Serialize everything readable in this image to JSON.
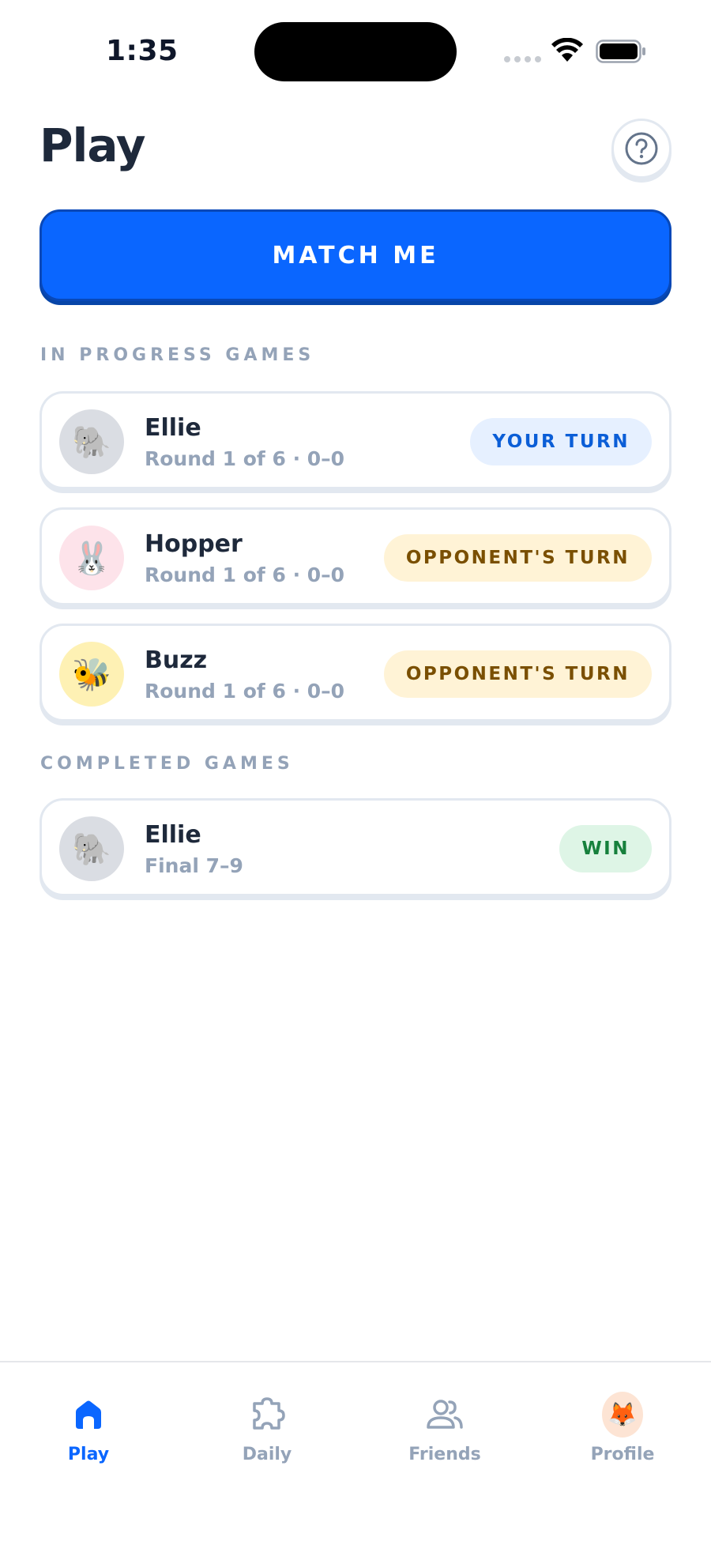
{
  "status_bar": {
    "time": "1:35"
  },
  "header": {
    "title": "Play",
    "help_icon": "question-circle-icon"
  },
  "match_button": {
    "label": "MATCH ME"
  },
  "in_progress": {
    "label": "IN PROGRESS GAMES",
    "games": [
      {
        "name": "Ellie",
        "subtitle": "Round 1 of 6 · 0–0",
        "avatar": "🐘",
        "avatar_bg": "#dadde3",
        "status": "YOUR TURN"
      },
      {
        "name": "Hopper",
        "subtitle": "Round 1 of 6 · 0–0",
        "avatar": "🐰",
        "avatar_bg": "#fde3ea",
        "status": "OPPONENT'S TURN"
      },
      {
        "name": "Buzz",
        "subtitle": "Round 1 of 6 · 0–0",
        "avatar": "🐝",
        "avatar_bg": "#fef1b4",
        "status": "OPPONENT'S TURN"
      }
    ]
  },
  "completed": {
    "label": "COMPLETED GAMES",
    "games": [
      {
        "name": "Ellie",
        "subtitle": "Final 7–9",
        "avatar": "🐘",
        "avatar_bg": "#dadde3",
        "status": "WIN"
      }
    ]
  },
  "tab_bar": {
    "tabs": [
      {
        "label": "Play",
        "icon": "home-icon",
        "active": true
      },
      {
        "label": "Daily",
        "icon": "puzzle-icon",
        "active": false
      },
      {
        "label": "Friends",
        "icon": "friends-icon",
        "active": false
      },
      {
        "label": "Profile",
        "icon": "fox-avatar",
        "active": false
      }
    ],
    "profile_avatar": "🦊"
  },
  "colors": {
    "accent": "#0a66ff",
    "your_turn_bg": "#e6f0ff",
    "opponent_turn_bg": "#fff3d6",
    "win_bg": "#def5e6"
  }
}
